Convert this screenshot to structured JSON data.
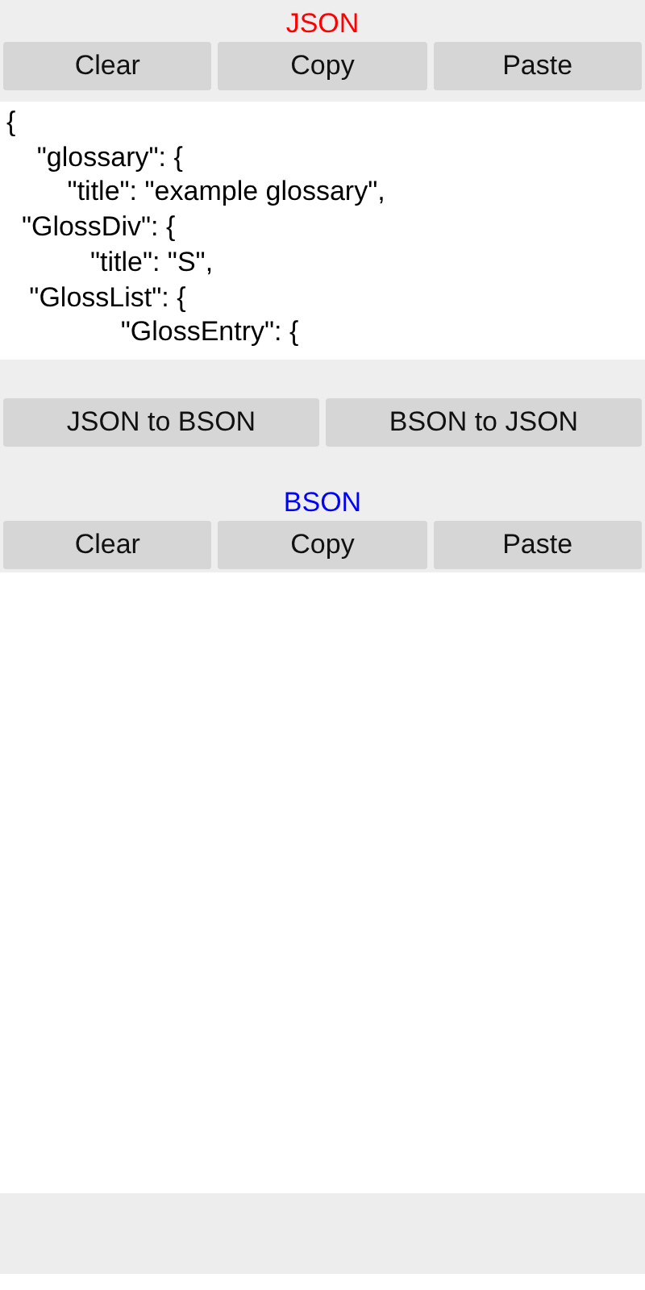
{
  "json_panel": {
    "title": "JSON",
    "buttons": [
      "Clear",
      "Copy",
      "Paste"
    ],
    "input": {
      "value": [
        "{",
        "    \"glossary\": {",
        "        \"title\": \"example glossary\",",
        "  \"GlossDiv\": {",
        "           \"title\": \"S\",",
        "   \"GlossList\": {",
        "               \"GlossEntry\": {"
      ]
    }
  },
  "convert_buttons": [
    "JSON to BSON",
    "BSON to JSON"
  ],
  "bson_panel": {
    "title": "BSON",
    "buttons": [
      "Clear",
      "Copy",
      "Paste"
    ]
  }
}
